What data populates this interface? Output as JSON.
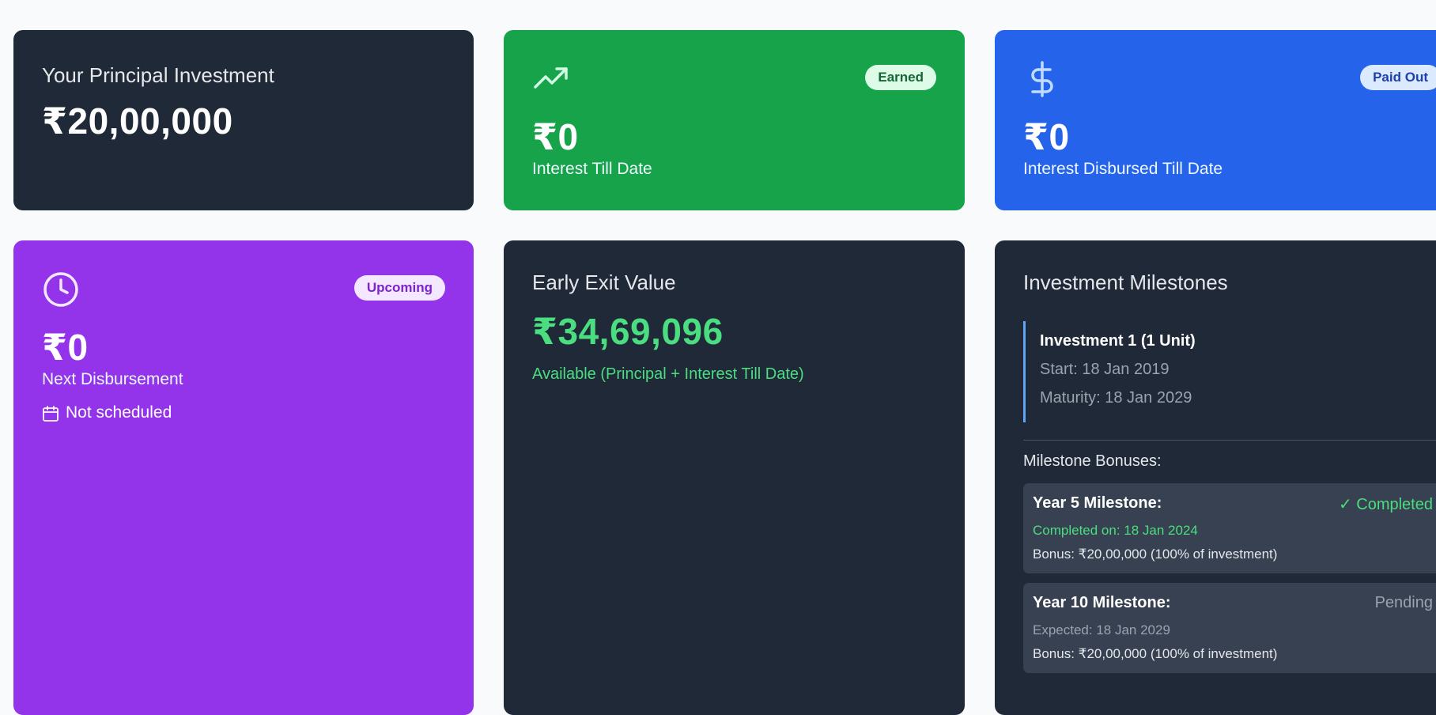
{
  "principal": {
    "title": "Your Principal Investment",
    "amount": "₹20,00,000"
  },
  "interest": {
    "icon": "trending-up-icon",
    "badge": "Earned",
    "amount": "₹0",
    "label": "Interest Till Date"
  },
  "disbursed": {
    "icon": "dollar-icon",
    "badge": "Paid Out",
    "amount": "₹0",
    "label": "Interest Disbursed Till Date"
  },
  "next": {
    "icon": "clock-icon",
    "badge": "Upcoming",
    "amount": "₹0",
    "label": "Next Disbursement",
    "schedule_icon": "calendar-icon",
    "schedule": "Not scheduled"
  },
  "exit": {
    "title": "Early Exit Value",
    "amount": "₹34,69,096",
    "note": "Available (Principal + Interest Till Date)"
  },
  "milestones": {
    "title": "Investment Milestones",
    "investment": {
      "name": "Investment 1 (1 Unit)",
      "start": "Start: 18 Jan 2019",
      "maturity": "Maturity: 18 Jan 2029"
    },
    "bonus_heading": "Milestone Bonuses:",
    "items": [
      {
        "title": "Year 5 Milestone:",
        "status": "✓ Completed",
        "date": "Completed on: 18 Jan 2024",
        "bonus": "Bonus: ₹20,00,000 (100% of investment)"
      },
      {
        "title": "Year 10 Milestone:",
        "status": "Pending",
        "date": "Expected: 18 Jan 2029",
        "bonus": "Bonus: ₹20,00,000 (100% of investment)"
      }
    ]
  },
  "colors": {
    "dark_card": "#1f2937",
    "green_card": "#16a34a",
    "blue_card": "#2563eb",
    "purple_card": "#9333ea",
    "accent_green": "#4ade80",
    "milestone_border": "#60a5fa"
  }
}
